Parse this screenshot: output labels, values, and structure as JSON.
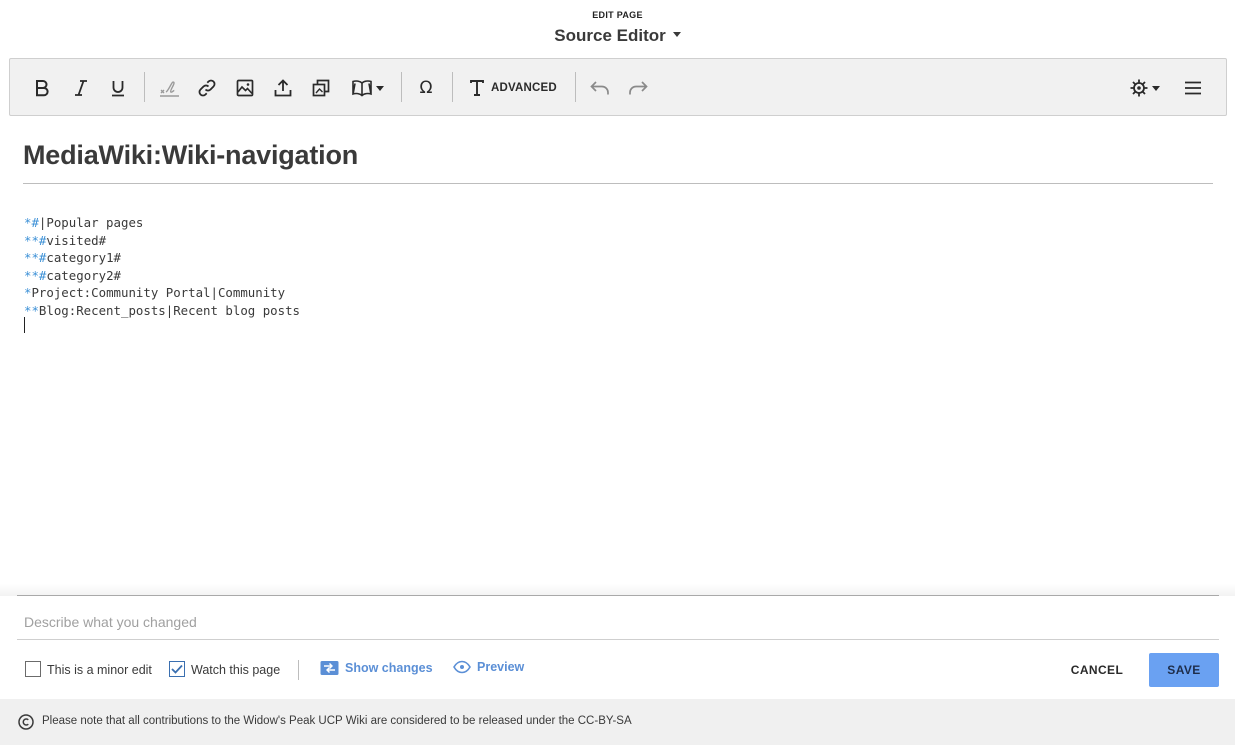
{
  "header": {
    "kicker": "EDIT PAGE",
    "mode_label": "Source Editor"
  },
  "toolbar": {
    "buttons": [
      {
        "name": "bold",
        "glyph": "B"
      },
      {
        "name": "italic",
        "glyph": "I"
      },
      {
        "name": "underline",
        "glyph": "U"
      },
      {
        "name": "signature",
        "icon": "signature-icon"
      },
      {
        "name": "link",
        "icon": "link-icon"
      },
      {
        "name": "image",
        "icon": "image-icon"
      },
      {
        "name": "upload",
        "icon": "upload-icon"
      },
      {
        "name": "gallery",
        "icon": "gallery-icon"
      },
      {
        "name": "reference",
        "icon": "book-icon"
      },
      {
        "name": "special-characters",
        "glyph": "Ω"
      },
      {
        "name": "undo",
        "icon": "undo-icon"
      },
      {
        "name": "redo",
        "icon": "redo-icon"
      },
      {
        "name": "settings",
        "icon": "gear-icon"
      },
      {
        "name": "menu",
        "icon": "hamburger-icon"
      }
    ],
    "advanced_label": "ADVANCED"
  },
  "page_title": "MediaWiki:Wiki-navigation",
  "editor_lines": [
    {
      "marker": "*#",
      "text": "|Popular pages"
    },
    {
      "marker": "**#",
      "text": "visited#"
    },
    {
      "marker": "**#",
      "text": "category1#"
    },
    {
      "marker": "**#",
      "text": "category2#"
    },
    {
      "marker": "*",
      "text": "Project:Community Portal|Community"
    },
    {
      "marker": "**",
      "text": "Blog:Recent_posts|Recent blog posts"
    }
  ],
  "summary": {
    "placeholder": "Describe what you changed",
    "value": ""
  },
  "options": {
    "minor_edit_label": "This is a minor edit",
    "minor_edit_checked": false,
    "watch_label": "Watch this page",
    "watch_checked": true
  },
  "actions": {
    "show_changes": "Show changes",
    "preview": "Preview",
    "cancel": "CANCEL",
    "save": "SAVE"
  },
  "footer": {
    "notice": "Please note that all contributions to the Widow's Peak UCP Wiki are considered to be released under the CC-BY-SA"
  },
  "colors": {
    "accent": "#5b8fd6",
    "save_button": "#6aa1f2",
    "wikitext_marker": "#3a8fd6",
    "toolbar_bg": "#f1f1f1",
    "footer_bg": "#f0f0f0"
  }
}
